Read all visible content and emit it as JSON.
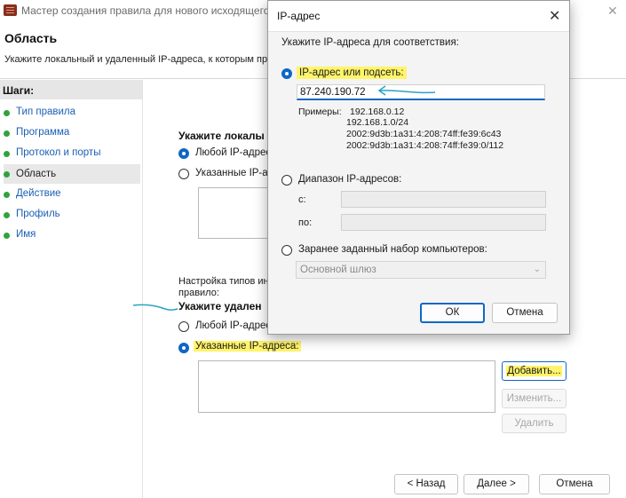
{
  "wizard": {
    "title": "Мастер создания правила для нового исходящего",
    "close_glyph": "✕",
    "page_title": "Область",
    "page_desc": "Укажите локальный и удаленный IP-адреса, к которым пра",
    "steps_header": "Шаги:",
    "steps": [
      {
        "label": "Тип правила"
      },
      {
        "label": "Программа"
      },
      {
        "label": "Протокол и порты"
      },
      {
        "label": "Область"
      },
      {
        "label": "Действие"
      },
      {
        "label": "Профиль"
      },
      {
        "label": "Имя"
      }
    ],
    "local_section": {
      "heading": "Укажите локалы",
      "any_label": "Любой IP-адрес",
      "specific_label": "Указанные IP-а"
    },
    "customize_text": {
      "line1": "Настройка типов ин",
      "line2": "правило:"
    },
    "remote_section": {
      "heading": "Укажите удален",
      "any_label": "Любой IP-адрес",
      "specific_label": "Указанные IP-адреса:"
    },
    "buttons": {
      "add": "Добавить...",
      "edit": "Изменить...",
      "remove": "Удалить",
      "back": "< Назад",
      "next": "Далее >",
      "cancel": "Отмена"
    }
  },
  "dialog": {
    "title": "IP-адрес",
    "close_glyph": "✕",
    "prompt": "Укажите IP-адреса для соответствия:",
    "option_subnet": "IP-адрес или подсеть:",
    "ip_value": "87.240.190.72",
    "examples_label": "Примеры:",
    "examples": [
      "192.168.0.12",
      "192.168.1.0/24",
      "2002:9d3b:1a31:4:208:74ff:fe39:6c43",
      "2002:9d3b:1a31:4:208:74ff:fe39:0/112"
    ],
    "option_range": "Диапазон IP-адресов:",
    "range_from_label": "с:",
    "range_to_label": "по:",
    "option_predefined": "Заранее заданный набор компьютеров:",
    "predefined_value": "Основной шлюз",
    "ok": "ОК",
    "cancel": "Отмена"
  },
  "colors": {
    "accent": "#0f67c5",
    "highlight": "#fff46a",
    "annotation": "#2aa3c4",
    "step_dot": "#2fa33c"
  }
}
